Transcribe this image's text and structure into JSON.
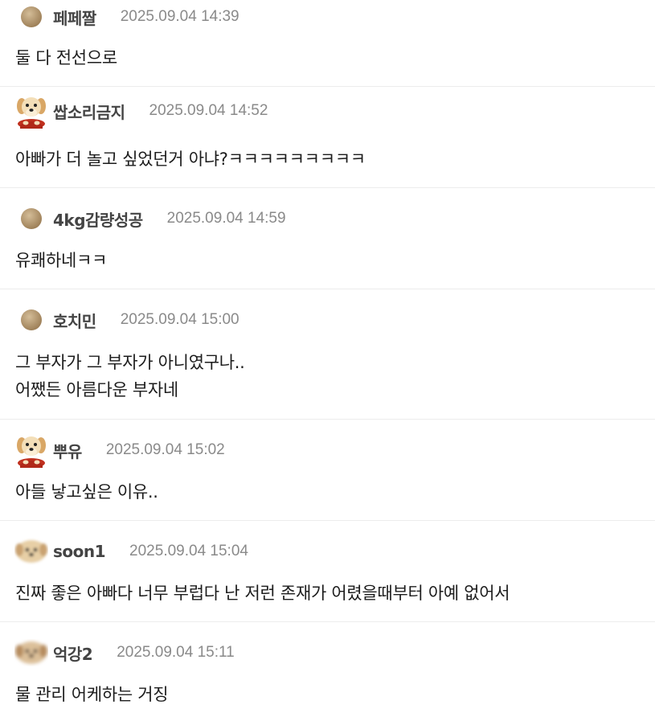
{
  "comments": [
    {
      "avatar": "brown-dot-icon",
      "nickname": "페페짤",
      "time": "2025.09.04 14:39",
      "lines": [
        "둘 다 전선으로"
      ]
    },
    {
      "avatar": "puppy-icon",
      "nickname": "쌉소리금지",
      "time": "2025.09.04 14:52",
      "lines": [
        "아빠가 더 놀고 싶었던거 아냐?ㅋㅋㅋㅋㅋㅋㅋㅋㅋ"
      ]
    },
    {
      "avatar": "brown-dot-icon",
      "nickname": "4kg감량성공",
      "time": "2025.09.04 14:59",
      "lines": [
        "유쾌하네ㅋㅋ"
      ]
    },
    {
      "avatar": "brown-dot-icon",
      "nickname": "호치민",
      "time": "2025.09.04 15:00",
      "lines": [
        "그 부자가 그 부자가 아니였구나..",
        "어쨌든 아름다운 부자네"
      ]
    },
    {
      "avatar": "puppy-icon",
      "nickname": "뿌유",
      "time": "2025.09.04 15:02",
      "lines": [
        "아들 낳고싶은 이유.."
      ]
    },
    {
      "avatar": "blurry-dog-icon",
      "nickname": "soon1",
      "time": "2025.09.04 15:04",
      "lines": [
        "진짜 좋은 아빠다 너무 부럽다 난 저런 존재가 어렸을때부터 아예 없어서"
      ]
    },
    {
      "avatar": "blurry-dog-icon",
      "nickname": "억강2",
      "time": "2025.09.04 15:11",
      "lines": [
        "물 관리 어케하는 거징"
      ]
    }
  ],
  "colors": {
    "nickname": "#444444",
    "timestamp": "#8a8a8a",
    "divider": "#ececec",
    "brown_dot": "#b59a74"
  }
}
